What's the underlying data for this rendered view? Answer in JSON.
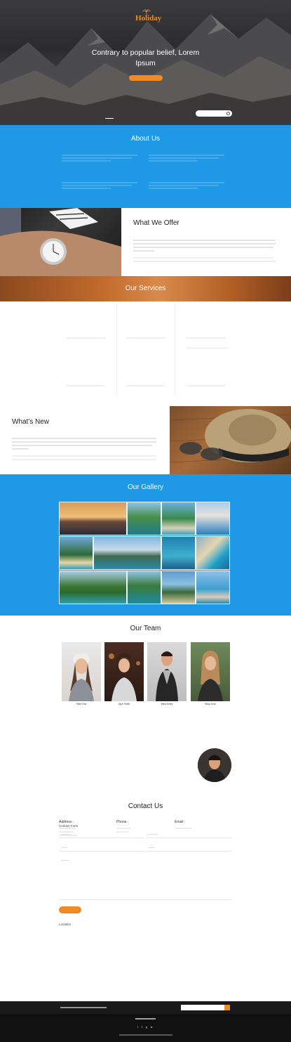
{
  "hero": {
    "logo_text": "Holiday",
    "logo_tagline": "",
    "title_line1": "Contrary to popular belief, Lorem",
    "title_line2": "Ipsum",
    "cta_label": "",
    "subtext": "",
    "nav": [
      "",
      "",
      "",
      "",
      "",
      ""
    ],
    "search_placeholder": ""
  },
  "about": {
    "title": "About Us",
    "items": [
      {
        "heading": "",
        "text": ""
      },
      {
        "heading": "",
        "text": ""
      },
      {
        "heading": "",
        "text": ""
      },
      {
        "heading": "",
        "text": ""
      }
    ]
  },
  "offer": {
    "title": "What We Offer",
    "heading": "",
    "text1": "",
    "text2": ""
  },
  "services": {
    "title": "Our Services",
    "items": [
      "",
      "",
      "",
      "",
      "",
      ""
    ]
  },
  "whats_new": {
    "title": "What's New",
    "heading": "",
    "text1": "",
    "text2": ""
  },
  "gallery": {
    "title": "Our Gallery"
  },
  "team": {
    "title": "Our Team",
    "members": [
      {
        "name": "Fikre Doe",
        "role": ""
      },
      {
        "name": "Jaye Smith",
        "role": ""
      },
      {
        "name": "Mike Arney",
        "role": ""
      },
      {
        "name": "Mary Jone",
        "role": ""
      }
    ]
  },
  "contact": {
    "title": "Contact Us",
    "address_label": "Address :",
    "address_value": "",
    "phone_label": "Phone :",
    "phone_value": "",
    "email_label": "Email :",
    "email_value": "",
    "form_label": "Contact Form",
    "first_name_placeholder": "",
    "last_name_placeholder": "",
    "email_placeholder": "",
    "phone_placeholder": "",
    "message_placeholder": "",
    "send_label": "",
    "location_label": "Location"
  },
  "footer": {
    "newsletter_label": "",
    "newsletter_placeholder": "",
    "social_title": "",
    "icons": [
      "f",
      "t",
      "g",
      "in"
    ],
    "copyright": ""
  },
  "colors": {
    "primary_blue": "#1f98e6",
    "accent_orange": "#f08a24",
    "dark": "#111111"
  }
}
